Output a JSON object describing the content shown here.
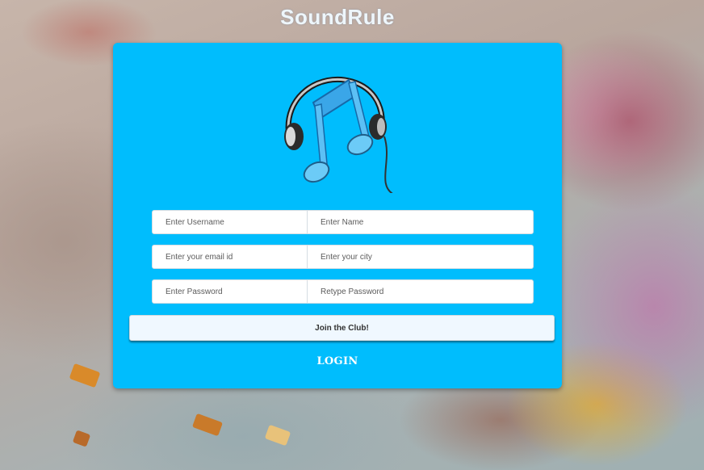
{
  "app": {
    "title": "SoundRule"
  },
  "logo": {
    "icon": "headphones-music-note-icon"
  },
  "form": {
    "username_placeholder": "Enter Username",
    "name_placeholder": "Enter Name",
    "email_placeholder": "Enter your email id",
    "city_placeholder": "Enter your city",
    "password_placeholder": "Enter Password",
    "retype_password_placeholder": "Retype Password",
    "submit_label": "Join the Club!",
    "login_link": "LOGIN"
  },
  "colors": {
    "card": "#00bdfd",
    "button_bg": "#f0f8ff",
    "title_text": "#eef6fb"
  }
}
